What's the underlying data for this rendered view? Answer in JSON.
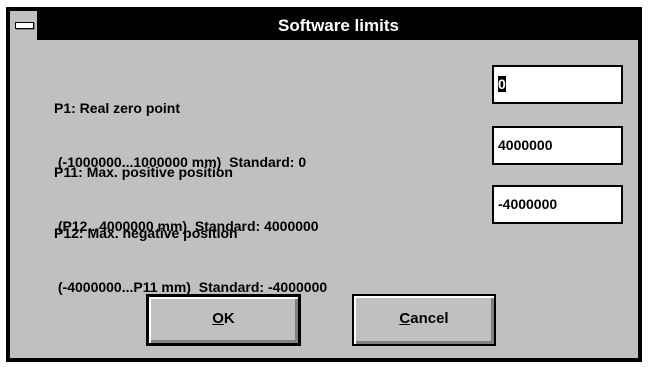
{
  "window": {
    "title": "Software limits"
  },
  "params": [
    {
      "name": "P1: Real zero point",
      "range": " (-1000000...1000000 mm)  Standard: 0",
      "value": "0"
    },
    {
      "name": "P11: Max. positive position",
      "range": " (P12...4000000 mm)  Standard: 4000000",
      "value": "4000000"
    },
    {
      "name": "P12: Max. negative position",
      "range": " (-4000000...P11 mm)  Standard: -4000000",
      "value": "-4000000"
    }
  ],
  "buttons": {
    "ok_accel": "O",
    "ok_rest": "K",
    "cancel_accel": "C",
    "cancel_rest": "ancel"
  },
  "icons": {
    "system_menu": "system-menu-icon"
  },
  "colors": {
    "titlebar": "#000000",
    "title_text": "#ffffff",
    "dialog_face": "#c0c0c0",
    "field_bg": "#ffffff"
  }
}
